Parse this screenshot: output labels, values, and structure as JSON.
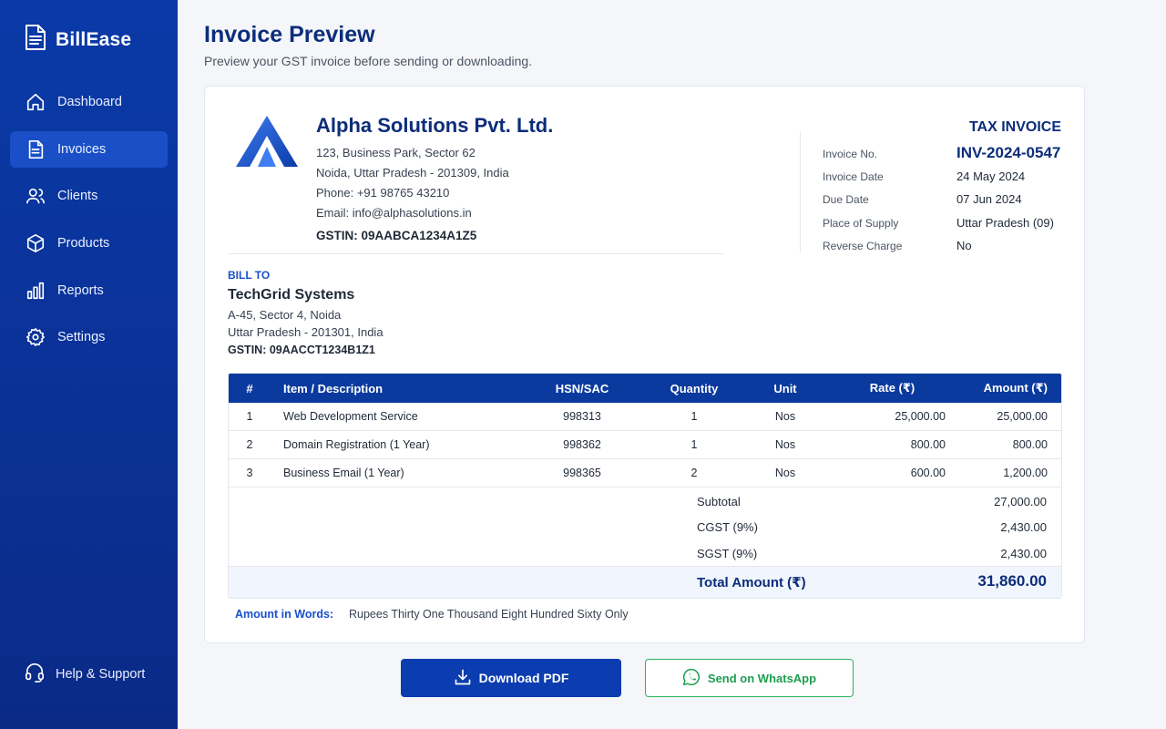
{
  "app": {
    "name": "BillEase"
  },
  "sidebar": {
    "items": [
      {
        "label": "Dashboard",
        "icon": "home-icon",
        "active": false
      },
      {
        "label": "Invoices",
        "icon": "document-icon",
        "active": true
      },
      {
        "label": "Clients",
        "icon": "users-icon",
        "active": false
      },
      {
        "label": "Products",
        "icon": "box-icon",
        "active": false
      },
      {
        "label": "Reports",
        "icon": "bar-chart-icon",
        "active": false
      },
      {
        "label": "Settings",
        "icon": "gear-icon",
        "active": false
      }
    ],
    "help_label": "Help & Support"
  },
  "header": {
    "title": "Invoice Preview",
    "subtitle": "Preview your GST invoice before sending or downloading."
  },
  "company": {
    "name": "Alpha Solutions Pvt. Ltd.",
    "address1": "123, Business Park, Sector 62",
    "address2": "Noida, Uttar Pradesh - 201309, India",
    "phone": "Phone: +91 98765 43210",
    "email": "Email: info@alphasolutions.in",
    "gstin": "GSTIN:  09AABCA1234A1Z5"
  },
  "invoice": {
    "doc_title": "TAX INVOICE",
    "fields": [
      {
        "label": "Invoice No.",
        "value": "INV-2024-0547"
      },
      {
        "label": "Invoice Date",
        "value": "24 May 2024"
      },
      {
        "label": "Due Date",
        "value": "07 Jun 2024"
      },
      {
        "label": "Place of Supply",
        "value": "Uttar Pradesh (09)"
      },
      {
        "label": "Reverse Charge",
        "value": "No"
      }
    ]
  },
  "bill_to": {
    "heading": "BILL TO",
    "name": "TechGrid Systems",
    "address1": "A-45, Sector 4, Noida",
    "address2": "Uttar Pradesh - 201301, India",
    "gstin": "GSTIN:  09AACCT1234B1Z1"
  },
  "table": {
    "headers": {
      "num": "#",
      "item": "Item / Description",
      "hsn": "HSN/SAC",
      "qty": "Quantity",
      "unit": "Unit",
      "rate": "Rate (₹)",
      "amount": "Amount (₹)"
    },
    "rows": [
      {
        "num": "1",
        "item": "Web Development Service",
        "hsn": "998313",
        "qty": "1",
        "unit": "Nos",
        "rate": "25,000.00",
        "amount": "25,000.00"
      },
      {
        "num": "2",
        "item": "Domain Registration (1 Year)",
        "hsn": "998362",
        "qty": "1",
        "unit": "Nos",
        "rate": "800.00",
        "amount": "800.00"
      },
      {
        "num": "3",
        "item": "Business Email (1 Year)",
        "hsn": "998365",
        "qty": "2",
        "unit": "Nos",
        "rate": "600.00",
        "amount": "1,200.00"
      }
    ],
    "totals": [
      {
        "label": "Subtotal",
        "value": "27,000.00"
      },
      {
        "label": "CGST (9%)",
        "value": "2,430.00"
      },
      {
        "label": "SGST (9%)",
        "value": "2,430.00"
      }
    ],
    "grand_label": "Total Amount (₹)",
    "grand_value": "31,860.00"
  },
  "words": {
    "label": "Amount in Words:",
    "value": "Rupees Thirty One Thousand Eight Hundred Sixty Only"
  },
  "actions": {
    "download_label": "Download PDF",
    "whatsapp_label": "Send on WhatsApp"
  },
  "colors": {
    "sidebar": "#0b3196",
    "accent": "#0c2d7a",
    "table_header": "#0a3a9e",
    "whatsapp": "#1e9e50"
  }
}
